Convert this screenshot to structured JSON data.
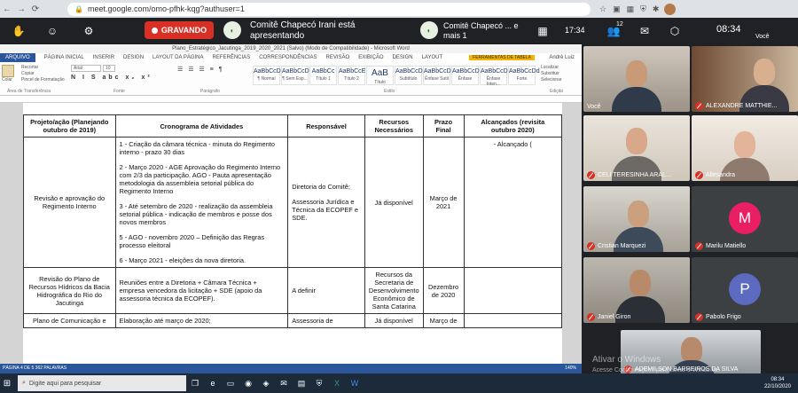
{
  "browser": {
    "url": "meet.google.com/omo-pfhk-kqg?authuser=1",
    "nav_back": "←",
    "nav_forward": "→",
    "nav_reload": "⟳",
    "home": "⌂",
    "lock": "🔒"
  },
  "meet": {
    "recording_label": "GRAVANDO",
    "presenting_text": "Comitê Chapecó Irani está apresentando",
    "presentation_chip": "Comitê Chapecó ... e mais 1",
    "elapsed_time": "17:34",
    "clock": "08:34",
    "participants_count": "12",
    "self_label": "Você"
  },
  "word": {
    "title": "Plano_Estratégico_Jacutinga_2019_2020_2021 (Salvo) (Modo de Compatibilidade) - Microsoft Word",
    "context_tab": "FERRAMENTAS DE TABELA",
    "tabs": [
      "ARQUIVO",
      "PÁGINA INICIAL",
      "INSERIR",
      "DESIGN",
      "LAYOUT DA PÁGINA",
      "REFERÊNCIAS",
      "CORRESPONDÊNCIAS",
      "REVISÃO",
      "EXIBIÇÃO",
      "DESIGN",
      "LAYOUT"
    ],
    "font_name": "Arial",
    "font_size": "10",
    "clipboard": [
      "Colar",
      "Recortar",
      "Copiar",
      "Pincel de Formatação"
    ],
    "groups": [
      "Área de Transferência",
      "Fonte",
      "Parágrafo",
      "Estilo",
      "Edição"
    ],
    "styles": [
      {
        "sample": "AaBbCcDd",
        "name": "¶ Normal"
      },
      {
        "sample": "AaBbCcDd",
        "name": "¶ Sem Esp..."
      },
      {
        "sample": "AaBbCc",
        "name": "Título 1"
      },
      {
        "sample": "AaBbCcE",
        "name": "Título 2"
      },
      {
        "sample": "AaB",
        "name": "Título"
      },
      {
        "sample": "AaBbCcD",
        "name": "Subtítulo"
      },
      {
        "sample": "AaBbCcDd",
        "name": "Ênfase Sutil"
      },
      {
        "sample": "AaBbCcDd",
        "name": "Ênfase"
      },
      {
        "sample": "AaBbCcDd",
        "name": "Ênfase Inten..."
      },
      {
        "sample": "AaBbCcDd",
        "name": "Forte"
      }
    ],
    "editing": [
      "Localizar",
      "Substituir",
      "Selecionar"
    ],
    "user": "André Luiz",
    "status": "PÁGINA 4 DE 5    362 PALAVRAS",
    "zoom": "140%",
    "table": {
      "headers": [
        "Projeto/ação (Planejando outubro de 2019)",
        "Cronograma de Atividades",
        "Responsável",
        "Recursos Necessários",
        "Prazo Final",
        "Alcançados (revisita outubro 2020)"
      ],
      "rows": [
        {
          "project": "Revisão e aprovação do Regimento Interno",
          "schedule": [
            "1 - Criação da câmara técnica - minuta do Regimento interno - prazo 30 dias",
            "2 - Março 2020 - AGE Aprovação do Regimento Interno com 2/3 da participação. AGO - Pauta apresentação metodologia da assembleia setorial pública do Regimento Interno",
            "3 - Até setembro de 2020 - realização da assembleia setorial pública - indicação de membros e posse dos novos membros",
            "5 - AGO - novembro 2020 – Definição das Regras processo eleitoral",
            "6 - Março 2021 - eleições da nova diretoria."
          ],
          "responsible": [
            "Diretoria do Comitê;",
            "Assessoria Jurídica e Técnica da ECOPEF e SDE."
          ],
          "resources": "Já disponível",
          "deadline": "Março de 2021",
          "achieved": "- Alcançado ("
        },
        {
          "project": "Revisão do Plano de Recursos Hídricos da Bacia Hidrográfica do Rio do Jacutinga",
          "schedule": [
            "Reuniões entre a Diretoria + Câmara Técnica + empresa vencedora da licitação + SDE (apoio da assessoria técnica da ECOPEF)."
          ],
          "responsible": [
            "A definir"
          ],
          "resources": "Recursos da Secretaria de Desenvolvimento Econômico de Santa Catarina",
          "deadline": "Dezembro de 2020",
          "achieved": ""
        },
        {
          "project": "Plano de Comunicação e",
          "schedule": [
            "Elaboração até março de 2020;"
          ],
          "responsible": [
            "Assessoria de"
          ],
          "resources": "Já disponível",
          "deadline": "Março de",
          "achieved": ""
        }
      ]
    }
  },
  "participants": [
    {
      "name": "Você",
      "muted": false
    },
    {
      "name": "ALEXANDRE MATTHIE...",
      "muted": true
    },
    {
      "name": "CELI TERESINHA ARAL...",
      "muted": true
    },
    {
      "name": "Allesandra",
      "muted": true
    },
    {
      "name": "Cristian Marquezi",
      "muted": true
    },
    {
      "name": "Marilu Matiello",
      "muted": true,
      "initial": "M",
      "color": "#e91e63"
    },
    {
      "name": "Janiel Giron",
      "muted": true
    },
    {
      "name": "Pabolo Frigo",
      "muted": true,
      "initial": "P",
      "color": "#5c6bc0"
    },
    {
      "name": "ADEMILSON BARREIROS DA SILVA",
      "muted": true
    }
  ],
  "windows": {
    "search_placeholder": "Digite aqui para pesquisar",
    "tray_time": "08:34",
    "tray_date": "22/10/2020",
    "activate_title": "Ativar o Windows",
    "activate_sub": "Acesse Configurações para ativar o Windows."
  }
}
